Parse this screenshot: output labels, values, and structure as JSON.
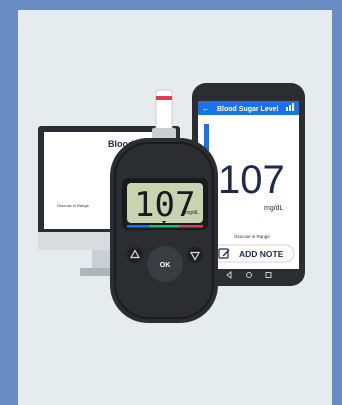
{
  "monitor": {
    "title": "Blood S",
    "caption": "Glucose in Range"
  },
  "phone": {
    "app_title": "Blood Sugar Level",
    "reading": "107",
    "unit": "mg/dL",
    "caption": "Glucose in Range",
    "add_note_label": "ADD NOTE"
  },
  "meter": {
    "reading": "107",
    "unit": "mg/dL",
    "ok_label": "OK"
  },
  "colors": {
    "frame": "#6a8cc4",
    "panel": "#e6ebee",
    "accent_blue": "#1a73e8",
    "accent_red": "#e23a55",
    "lcd_green": "#c9d3b0"
  }
}
